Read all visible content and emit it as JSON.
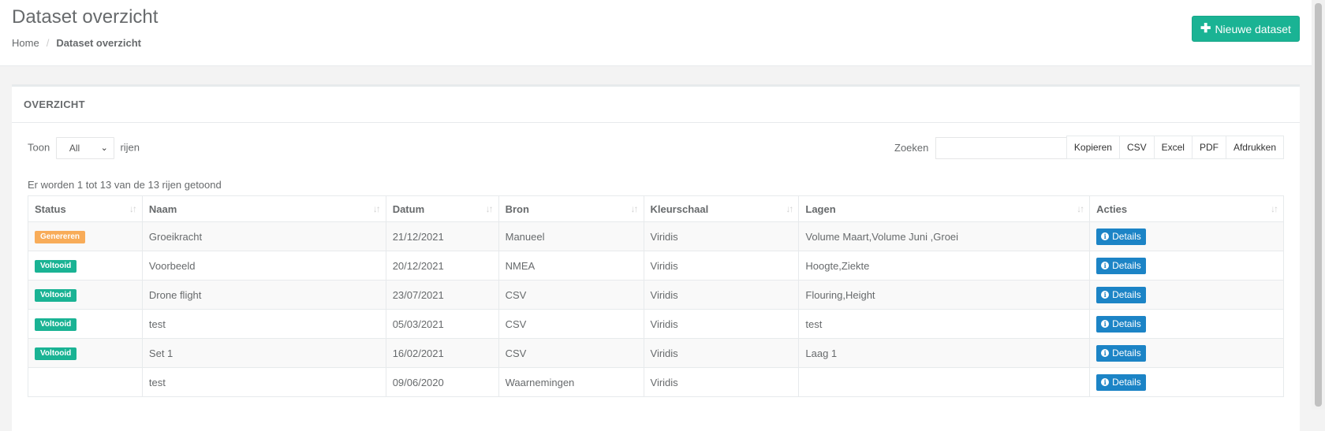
{
  "header": {
    "title": "Dataset overzicht",
    "breadcrumb": [
      {
        "label": "Home"
      },
      {
        "label": "Dataset overzicht"
      }
    ],
    "breadcrumb_sep": "/",
    "new_button_label": "Nieuwe dataset",
    "new_button_icon": "plus-icon"
  },
  "panel": {
    "title": "OVERZICHT",
    "length_prefix": "Toon",
    "length_value": "All",
    "length_suffix": "rijen",
    "search_label": "Zoeken",
    "search_value": "",
    "export_buttons": [
      "Kopieren",
      "CSV",
      "Excel",
      "PDF",
      "Afdrukken"
    ],
    "info_text": "Er worden 1 tot 13 van de 13 rijen getoond"
  },
  "table": {
    "columns": [
      "Status",
      "Naam",
      "Datum",
      "Bron",
      "Kleurschaal",
      "Lagen",
      "Acties"
    ],
    "details_label": "Details",
    "rows": [
      {
        "status": "Genereren",
        "status_color": "#f8ac59",
        "naam": "Groeikracht",
        "datum": "21/12/2021",
        "bron": "Manueel",
        "kleurschaal": "Viridis",
        "lagen": "Volume Maart,Volume Juni ,Groei"
      },
      {
        "status": "Voltooid",
        "status_color": "#1ab394",
        "naam": "Voorbeeld",
        "datum": "20/12/2021",
        "bron": "NMEA",
        "kleurschaal": "Viridis",
        "lagen": "Hoogte,Ziekte"
      },
      {
        "status": "Voltooid",
        "status_color": "#1ab394",
        "naam": "Drone flight",
        "datum": "23/07/2021",
        "bron": "CSV",
        "kleurschaal": "Viridis",
        "lagen": "Flouring,Height"
      },
      {
        "status": "Voltooid",
        "status_color": "#1ab394",
        "naam": "test",
        "datum": "05/03/2021",
        "bron": "CSV",
        "kleurschaal": "Viridis",
        "lagen": "test"
      },
      {
        "status": "Voltooid",
        "status_color": "#1ab394",
        "naam": "Set 1",
        "datum": "16/02/2021",
        "bron": "CSV",
        "kleurschaal": "Viridis",
        "lagen": "Laag 1"
      },
      {
        "status": "",
        "status_color": "",
        "naam": "test",
        "datum": "09/06/2020",
        "bron": "Waarnemingen",
        "kleurschaal": "Viridis",
        "lagen": ""
      }
    ]
  },
  "colors": {
    "primary": "#1ab394",
    "info": "#1c84c6",
    "warning": "#f8ac59"
  }
}
